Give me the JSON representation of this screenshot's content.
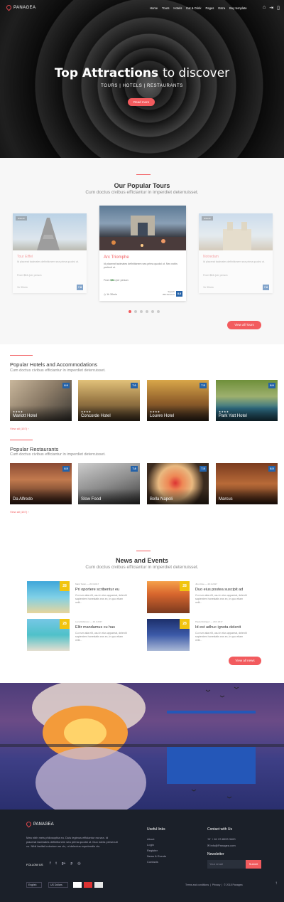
{
  "brand": "PANAGEA",
  "nav": {
    "menu": [
      "Home",
      "Tours",
      "Hotels",
      "Eat & Drink",
      "Pages",
      "Extra",
      "Buy template"
    ]
  },
  "hero": {
    "title_bold": "Top Attractions",
    "title_rest": "to discover",
    "subtitle": "TOURS | HOTELS | RESTAURANTS",
    "button": "Read more"
  },
  "tours": {
    "title": "Our Popular Tours",
    "subtitle": "Cum doctus civibus efficiantur in imperdiet deterruisset.",
    "items": [
      {
        "name": "Tour Eiffel",
        "tag": "Historic",
        "desc": "Id placerat tacimates definitionem sea prima quodsi ut.",
        "price": "From $54 /per person",
        "duration": "1h 30min",
        "super": "Superb",
        "reviews": "350 Reviews",
        "score": "7.8"
      },
      {
        "name": "Arc Triomphe",
        "tag": "",
        "desc": "Id placerat tacimates definitionem sea prima quodsi ut. Nec nobis prefecti ut.",
        "price_label": "From",
        "price_value": "$54",
        "price_unit": "/per person",
        "duration": "1h 30min",
        "super": "Superb",
        "reviews": "350 Reviews",
        "score": "8.8"
      },
      {
        "name": "Notredam",
        "tag": "Historic",
        "desc": "Id placerat tacimates definitionem sea prima quodsi ut.",
        "price": "From $54 /per person",
        "duration": "1h 30min",
        "super": "Superb",
        "reviews": "350 Reviews",
        "score": "7.8"
      }
    ],
    "view_all": "View all Tours"
  },
  "hotels": {
    "title": "Popular Hotels and Accommodations",
    "subtitle": "Cum doctus civibus efficiantur in imperdiet deterruisset.",
    "items": [
      {
        "name": "Mariott Hotel",
        "stars": "★★★★",
        "score": "8.9"
      },
      {
        "name": "Concorde Hotel",
        "stars": "★★★★",
        "score": "7.0"
      },
      {
        "name": "Louvre Hotel",
        "stars": "★★★★",
        "score": "7.5"
      },
      {
        "name": "Park Yatt Hotel",
        "stars": "★★★★",
        "score": "8.9"
      }
    ],
    "view_all": "View all (157)"
  },
  "restaurants": {
    "title": "Popular Restaurants",
    "subtitle": "Cum doctus civibus efficiantur in imperdiet deterruisset.",
    "items": [
      {
        "name": "Da Alfredo",
        "score": "8.5"
      },
      {
        "name": "Slow Food",
        "score": "7.8"
      },
      {
        "name": "Bella Napoli",
        "score": "7.5"
      },
      {
        "name": "Marcus",
        "score": "8.5"
      }
    ],
    "view_all": "View all (157)"
  },
  "news": {
    "title": "News and Events",
    "subtitle": "Cum doctus civibus efficiantur in imperdiet deterruisset.",
    "items": [
      {
        "date": "28",
        "meta": "Mark Twain  —  20.3.2017",
        "title": "Pri oportere scribentur eu",
        "desc": "Cu eum alia elit, usu in eius appareat, deleniti sapientem honestatis eos ex, in quo etiam velit..."
      },
      {
        "date": "28",
        "meta": "Jhon Doe  —  20.3.2017",
        "title": "Duo eius postea suscipit ad",
        "desc": "Cu eum alia elit, usu in eius appareat, deleniti sapientem honestatis eos ex, in quo etiam velit..."
      },
      {
        "date": "28",
        "meta": "Luca Robinson  —  20.3.2017",
        "title": "Elitr mandamus cu has",
        "desc": "Cu eum alia elit, usu in eius appareat, deleniti sapientem honestatis eos ex, in quo etiam velit..."
      },
      {
        "date": "28",
        "meta": "Paula Rodrigez  —  20.3.2017",
        "title": "Id est adhuc ignota delenit",
        "desc": "Cu eum alia elit, usu in eius appareat, deleniti sapientem honestatis eos ex, in quo etiam velit..."
      }
    ],
    "view_all": "View all news"
  },
  "footer": {
    "brand": "PANAGEA",
    "about": "Mea nibh meis philosophia eu. Duis legimus efficiantur ea sea. Id placerat tacimates definitionem sea prima quodsi ut. Duo nobis persecuti cu. Nihil facilisi indoctum an vix, ut delectus expetendis vis.",
    "follow": "FOLLOW US",
    "useful_links_title": "Useful links",
    "links": [
      "About",
      "Login",
      "Register",
      "News & Events",
      "Contacts"
    ],
    "contact_title": "Contact with Us",
    "phone": "+ 61 23 8093 3400",
    "email": "info@Panagea.com",
    "newsletter_title": "Newsletter",
    "newsletter_placeholder": "Your email",
    "newsletter_button": "Submit",
    "language": "English",
    "currency": "US Dollars",
    "bottom_links": [
      "Terms and conditions",
      "Privacy",
      "© 2018 Panagea"
    ]
  }
}
